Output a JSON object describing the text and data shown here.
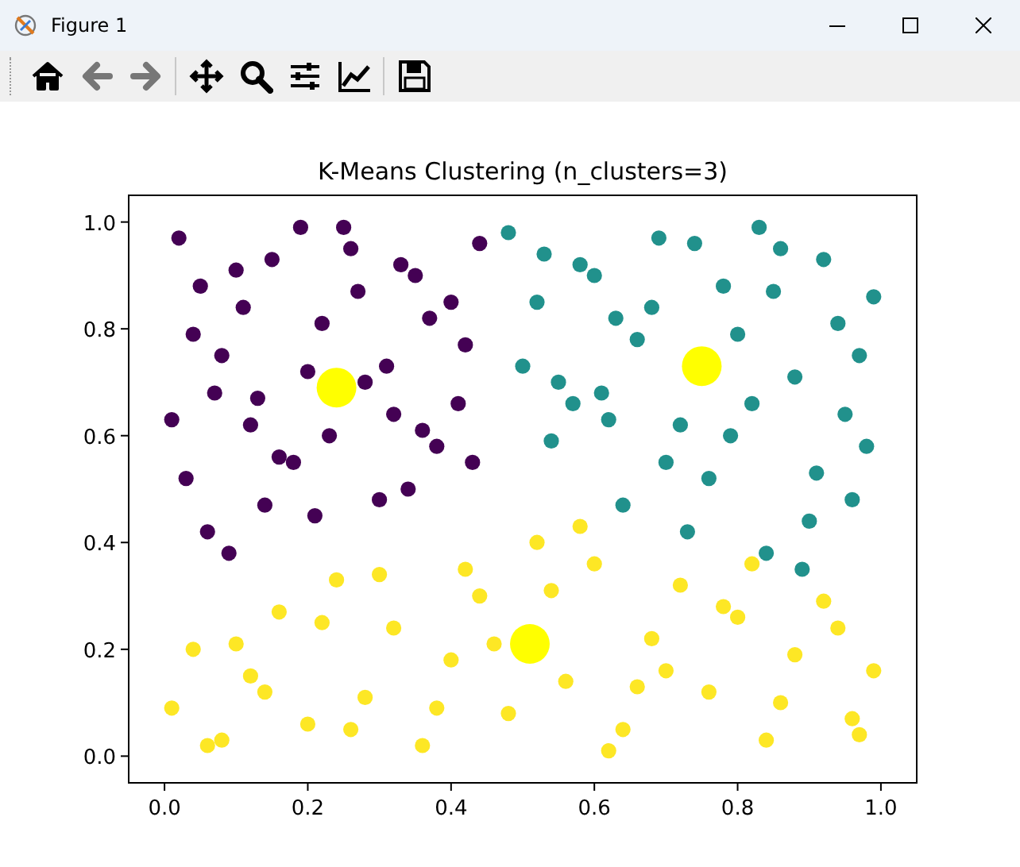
{
  "window": {
    "title": "Figure 1"
  },
  "figure": {
    "chart_data": {
      "type": "scatter",
      "title": "K-Means Clustering (n_clusters=3)",
      "xlim": [
        -0.05,
        1.05
      ],
      "ylim": [
        -0.05,
        1.05
      ],
      "xticks": [
        {
          "value": 0,
          "label": "0.0"
        },
        {
          "value": 0.2,
          "label": "0.2"
        },
        {
          "value": 0.4,
          "label": "0.4"
        },
        {
          "value": 0.6,
          "label": "0.6"
        },
        {
          "value": 0.8,
          "label": "0.8"
        },
        {
          "value": 1,
          "label": "1.0"
        }
      ],
      "yticks": [
        {
          "value": 0,
          "label": "0.0"
        },
        {
          "value": 0.2,
          "label": "0.2"
        },
        {
          "value": 0.4,
          "label": "0.4"
        },
        {
          "value": 0.6,
          "label": "0.6"
        },
        {
          "value": 0.8,
          "label": "0.8"
        },
        {
          "value": 1,
          "label": "1.0"
        }
      ],
      "series": [
        {
          "color": "#440154",
          "x": [
            0.02,
            0.05,
            0.08,
            0.12,
            0.15,
            0.18,
            0.22,
            0.25,
            0.28,
            0.32,
            0.35,
            0.38,
            0.42,
            0.44,
            0.03,
            0.07,
            0.11,
            0.14,
            0.19,
            0.23,
            0.27,
            0.31,
            0.34,
            0.37,
            0.41,
            0.01,
            0.06,
            0.1,
            0.16,
            0.2,
            0.26,
            0.3,
            0.36,
            0.4,
            0.43,
            0.04,
            0.09,
            0.13,
            0.21,
            0.33
          ],
          "values": [
            0.97,
            0.88,
            0.75,
            0.62,
            0.93,
            0.55,
            0.81,
            0.99,
            0.7,
            0.64,
            0.9,
            0.58,
            0.77,
            0.96,
            0.52,
            0.68,
            0.84,
            0.47,
            0.99,
            0.6,
            0.87,
            0.73,
            0.5,
            0.82,
            0.66,
            0.63,
            0.42,
            0.91,
            0.56,
            0.72,
            0.95,
            0.48,
            0.61,
            0.85,
            0.55,
            0.79,
            0.38,
            0.67,
            0.45,
            0.92
          ]
        },
        {
          "color": "#21918c",
          "x": [
            0.48,
            0.52,
            0.55,
            0.58,
            0.62,
            0.66,
            0.7,
            0.74,
            0.78,
            0.82,
            0.86,
            0.9,
            0.94,
            0.98,
            0.5,
            0.54,
            0.6,
            0.64,
            0.68,
            0.72,
            0.76,
            0.8,
            0.84,
            0.88,
            0.92,
            0.96,
            0.57,
            0.63,
            0.69,
            0.79,
            0.85,
            0.91,
            0.97,
            0.53,
            0.61,
            0.73,
            0.83,
            0.89,
            0.95,
            0.99
          ],
          "values": [
            0.98,
            0.85,
            0.7,
            0.92,
            0.63,
            0.78,
            0.55,
            0.96,
            0.88,
            0.66,
            0.95,
            0.44,
            0.81,
            0.58,
            0.73,
            0.59,
            0.9,
            0.47,
            0.84,
            0.62,
            0.52,
            0.79,
            0.38,
            0.71,
            0.93,
            0.48,
            0.66,
            0.82,
            0.97,
            0.6,
            0.87,
            0.53,
            0.75,
            0.94,
            0.68,
            0.42,
            0.99,
            0.35,
            0.64,
            0.86
          ]
        },
        {
          "color": "#fde725",
          "x": [
            0.01,
            0.04,
            0.08,
            0.12,
            0.16,
            0.2,
            0.24,
            0.28,
            0.32,
            0.36,
            0.4,
            0.44,
            0.48,
            0.52,
            0.56,
            0.6,
            0.64,
            0.68,
            0.72,
            0.76,
            0.8,
            0.84,
            0.88,
            0.92,
            0.96,
            0.99,
            0.06,
            0.14,
            0.22,
            0.3,
            0.38,
            0.46,
            0.54,
            0.62,
            0.7,
            0.78,
            0.86,
            0.94,
            0.1,
            0.26,
            0.42,
            0.58,
            0.66,
            0.82,
            0.97
          ],
          "values": [
            0.09,
            0.2,
            0.03,
            0.15,
            0.27,
            0.06,
            0.33,
            0.11,
            0.24,
            0.02,
            0.18,
            0.3,
            0.08,
            0.4,
            0.14,
            0.36,
            0.05,
            0.22,
            0.32,
            0.12,
            0.26,
            0.03,
            0.19,
            0.29,
            0.07,
            0.16,
            0.02,
            0.12,
            0.25,
            0.34,
            0.09,
            0.21,
            0.31,
            0.01,
            0.16,
            0.28,
            0.1,
            0.24,
            0.21,
            0.05,
            0.35,
            0.43,
            0.13,
            0.36,
            0.04
          ]
        },
        {
          "color": "#ffff00",
          "x": [
            0.24,
            0.75,
            0.51
          ],
          "values": [
            0.69,
            0.73,
            0.21
          ]
        }
      ]
    }
  }
}
